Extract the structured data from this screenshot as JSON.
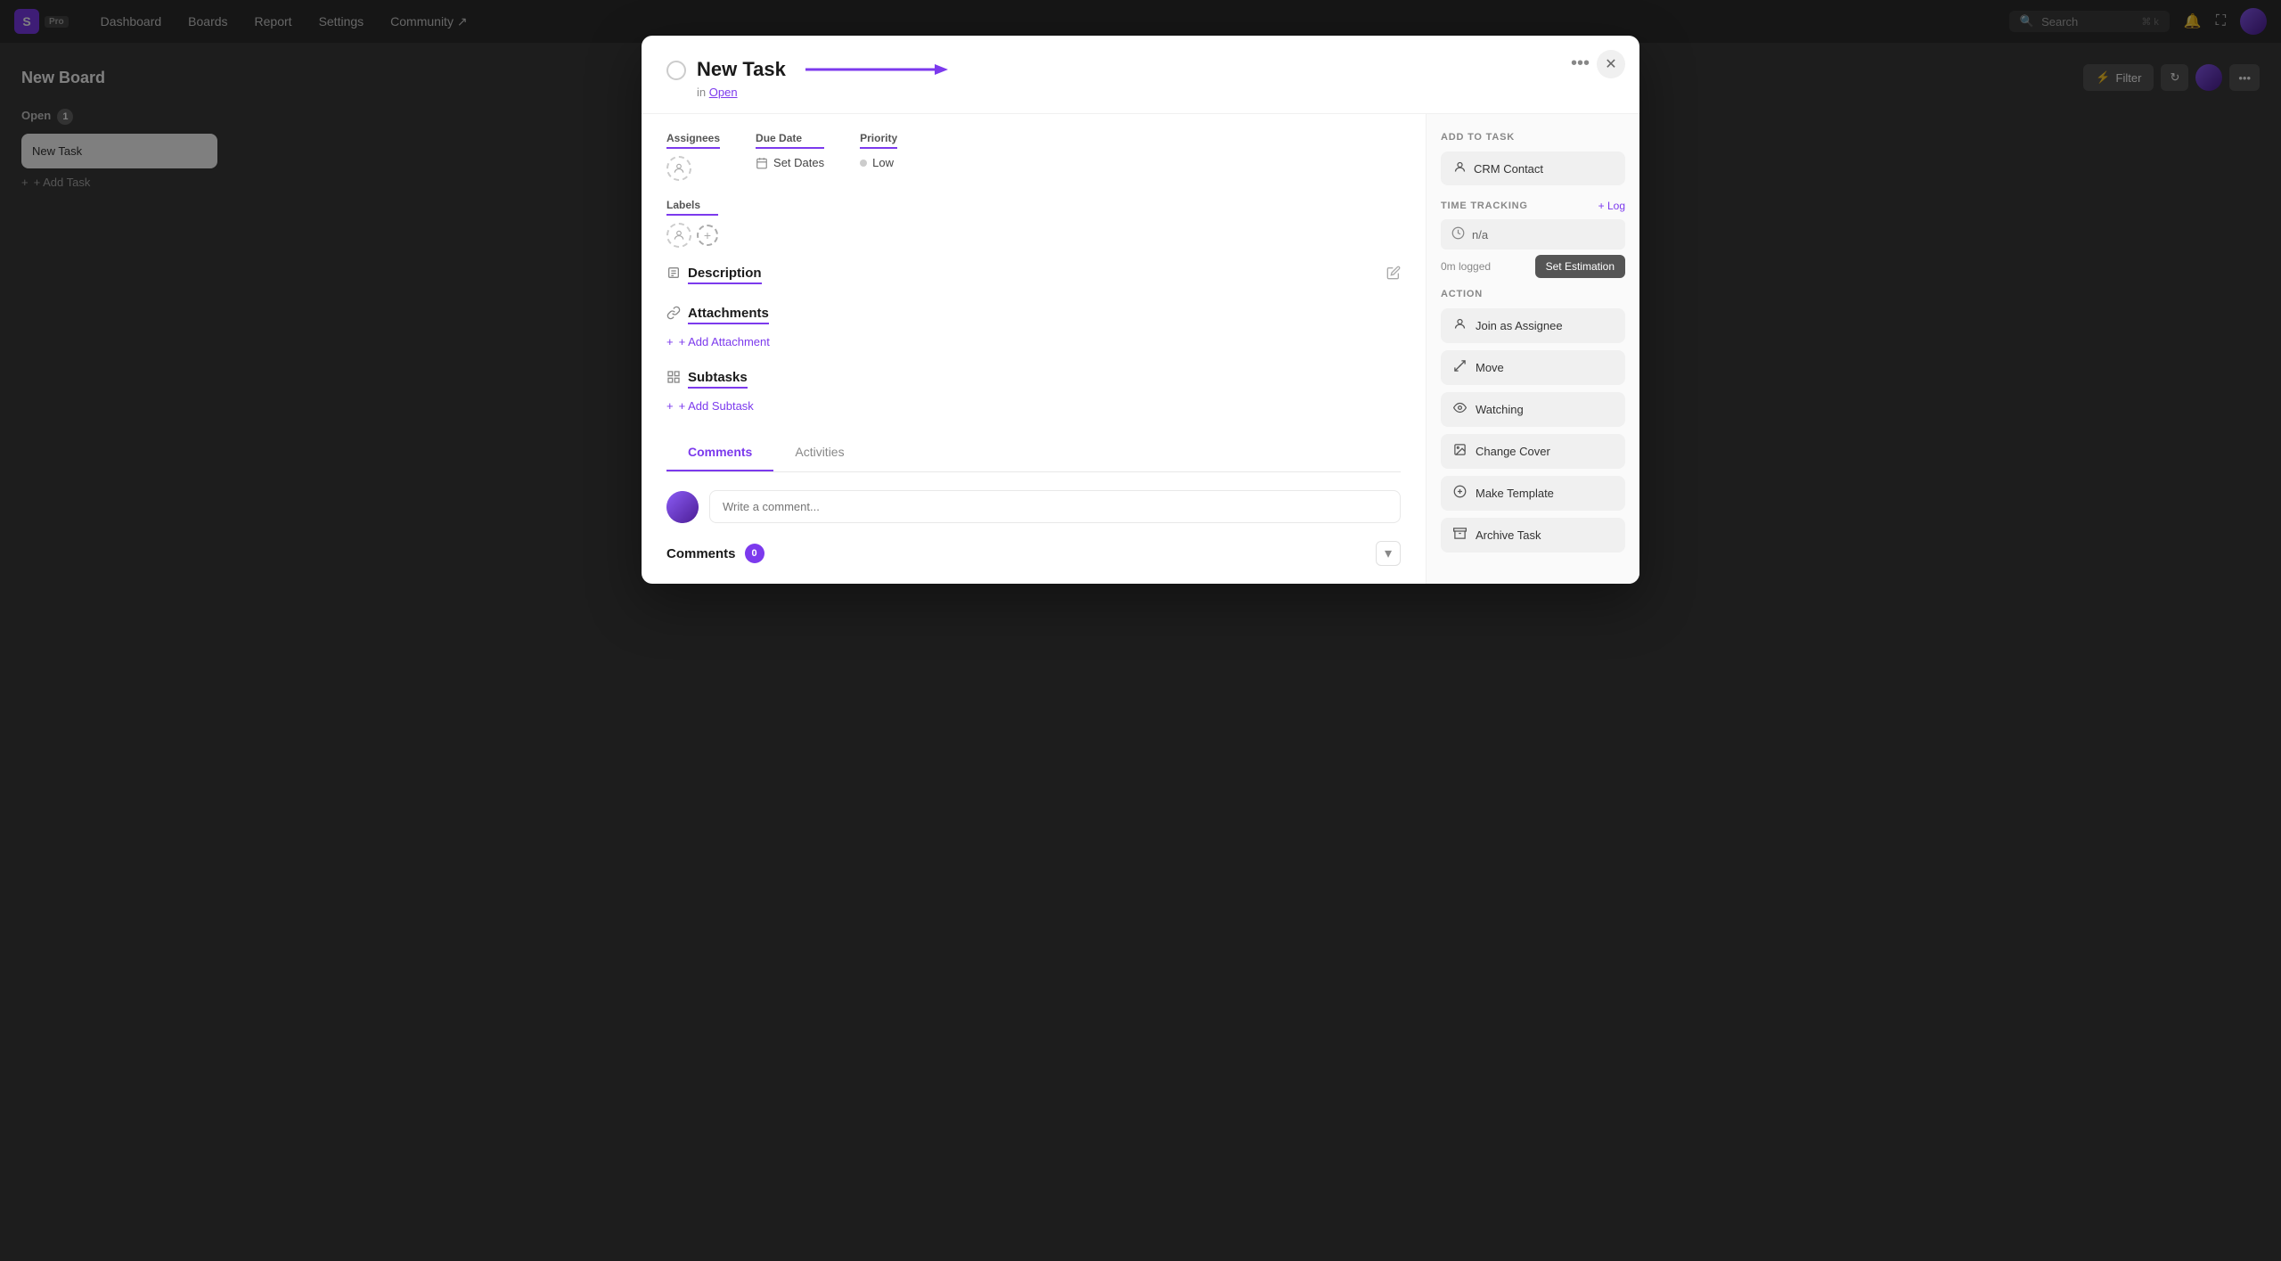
{
  "topbar": {
    "logo_letter": "S",
    "pro_label": "Pro",
    "nav_items": [
      "Dashboard",
      "Boards",
      "Report",
      "Settings",
      "Community ↗"
    ],
    "search_placeholder": "Search",
    "search_shortcut": "⌘ k"
  },
  "board": {
    "title": "New Board",
    "filter_label": "Filter",
    "columns": [
      {
        "name": "Open",
        "count": 1,
        "tasks": [
          "New Task"
        ]
      }
    ],
    "add_task_label": "+ Add Task"
  },
  "modal": {
    "task_title": "New Task",
    "task_subtitle_prefix": "in",
    "task_subtitle_link": "Open",
    "assignees_label": "Assignees",
    "due_date_label": "Due Date",
    "due_date_value": "Set Dates",
    "priority_label": "Priority",
    "priority_value": "Low",
    "labels_label": "Labels",
    "description_label": "Description",
    "attachments_label": "Attachments",
    "add_attachment_label": "+ Add Attachment",
    "subtasks_label": "Subtasks",
    "add_subtask_label": "+ Add Subtask",
    "tabs": [
      "Comments",
      "Activities"
    ],
    "active_tab": "Comments",
    "comment_placeholder": "Write a comment...",
    "comments_section_title": "Comments",
    "comments_count": "0",
    "sidebar": {
      "add_to_task_title": "ADD TO TASK",
      "crm_contact_label": "CRM Contact",
      "time_tracking_title": "TIME TRACKING",
      "time_log_label": "+ Log",
      "time_value": "n/a",
      "time_logged": "0m logged",
      "set_estimation_label": "Set Estimation",
      "action_title": "ACTION",
      "actions": [
        {
          "icon": "person",
          "label": "Join as Assignee"
        },
        {
          "icon": "arrow-up-right",
          "label": "Move"
        },
        {
          "icon": "eye",
          "label": "Watching"
        },
        {
          "icon": "image",
          "label": "Change Cover"
        },
        {
          "icon": "plus-circle",
          "label": "Make Template"
        },
        {
          "icon": "archive",
          "label": "Archive Task"
        }
      ]
    }
  }
}
